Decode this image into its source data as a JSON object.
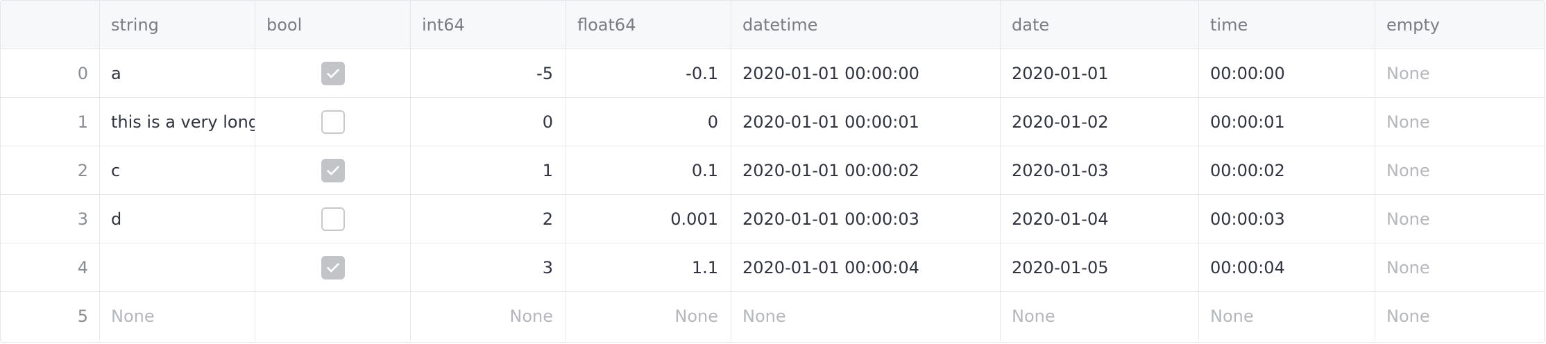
{
  "columns": [
    "",
    "string",
    "bool",
    "int64",
    "float64",
    "datetime",
    "date",
    "time",
    "empty"
  ],
  "rows": [
    {
      "index": "0",
      "string": "a",
      "bool": true,
      "int64": "-5",
      "float64": "-0.1",
      "datetime": "2020-01-01 00:00:00",
      "date": "2020-01-01",
      "time": "00:00:00",
      "empty": "None"
    },
    {
      "index": "1",
      "string": "this is a very long",
      "bool": false,
      "int64": "0",
      "float64": "0",
      "datetime": "2020-01-01 00:00:01",
      "date": "2020-01-02",
      "time": "00:00:01",
      "empty": "None"
    },
    {
      "index": "2",
      "string": "c",
      "bool": true,
      "int64": "1",
      "float64": "0.1",
      "datetime": "2020-01-01 00:00:02",
      "date": "2020-01-03",
      "time": "00:00:02",
      "empty": "None"
    },
    {
      "index": "3",
      "string": "d",
      "bool": false,
      "int64": "2",
      "float64": "0.001",
      "datetime": "2020-01-01 00:00:03",
      "date": "2020-01-04",
      "time": "00:00:03",
      "empty": "None"
    },
    {
      "index": "4",
      "string": "",
      "bool": true,
      "int64": "3",
      "float64": "1.1",
      "datetime": "2020-01-01 00:00:04",
      "date": "2020-01-05",
      "time": "00:00:04",
      "empty": "None"
    },
    {
      "index": "5",
      "string": "None",
      "bool": null,
      "int64": "None",
      "float64": "None",
      "datetime": "None",
      "date": "None",
      "time": "None",
      "empty": "None"
    }
  ],
  "colors": {
    "header_bg": "#f7f8fa",
    "border": "#e6e7eb",
    "text": "#31333f",
    "muted_text": "#b5b7bd",
    "checkbox_checked": "#c3c4c8"
  },
  "icons": {
    "checked": "check-icon"
  }
}
